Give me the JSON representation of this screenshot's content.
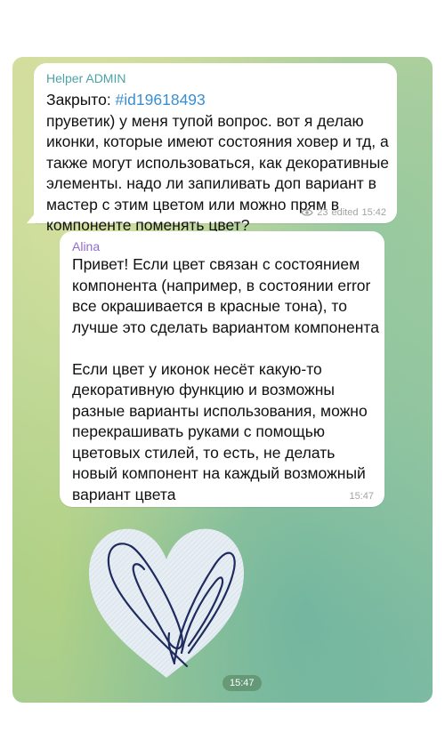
{
  "messages": [
    {
      "sender": "Helper ADMIN",
      "text_prefix": "Закрыто: ",
      "hashtag": "#id19618493",
      "text_body": "пруветик) у меня тупой вопрос. вот я делаю иконки, которые имеют состояния ховер и тд, а также могут использоваться, как декоративные элементы. надо ли запиливать доп вариант в мастер с этим цветом или можно прям в компоненте поменять цвет?",
      "views": "23",
      "edited_label": "edited",
      "time": "15:42"
    },
    {
      "sender": "Alina",
      "text": "Привет! Если цвет связан с состоянием компонента (например, в состоянии error все окрашивается в красные тона), то лучше это сделать вариантом компонента\n\nЕсли цвет у иконок несёт какую-то декоративную функцию и возможны разные варианты использования, можно перекрашивать руками с помощью цветовых стилей, то есть, не делать новый компонент на каждый возможный вариант цвета",
      "time": "15:47"
    }
  ],
  "sticker": {
    "icon": "heart-paperclip-sticker",
    "time": "15:47"
  },
  "colors": {
    "sender_1": "#4ba3a8",
    "sender_2": "#8f6dc9",
    "hashtag": "#3a8fd1",
    "sticker_fill": "#e6eef4",
    "sticker_stroke": "#1f2a5e"
  }
}
